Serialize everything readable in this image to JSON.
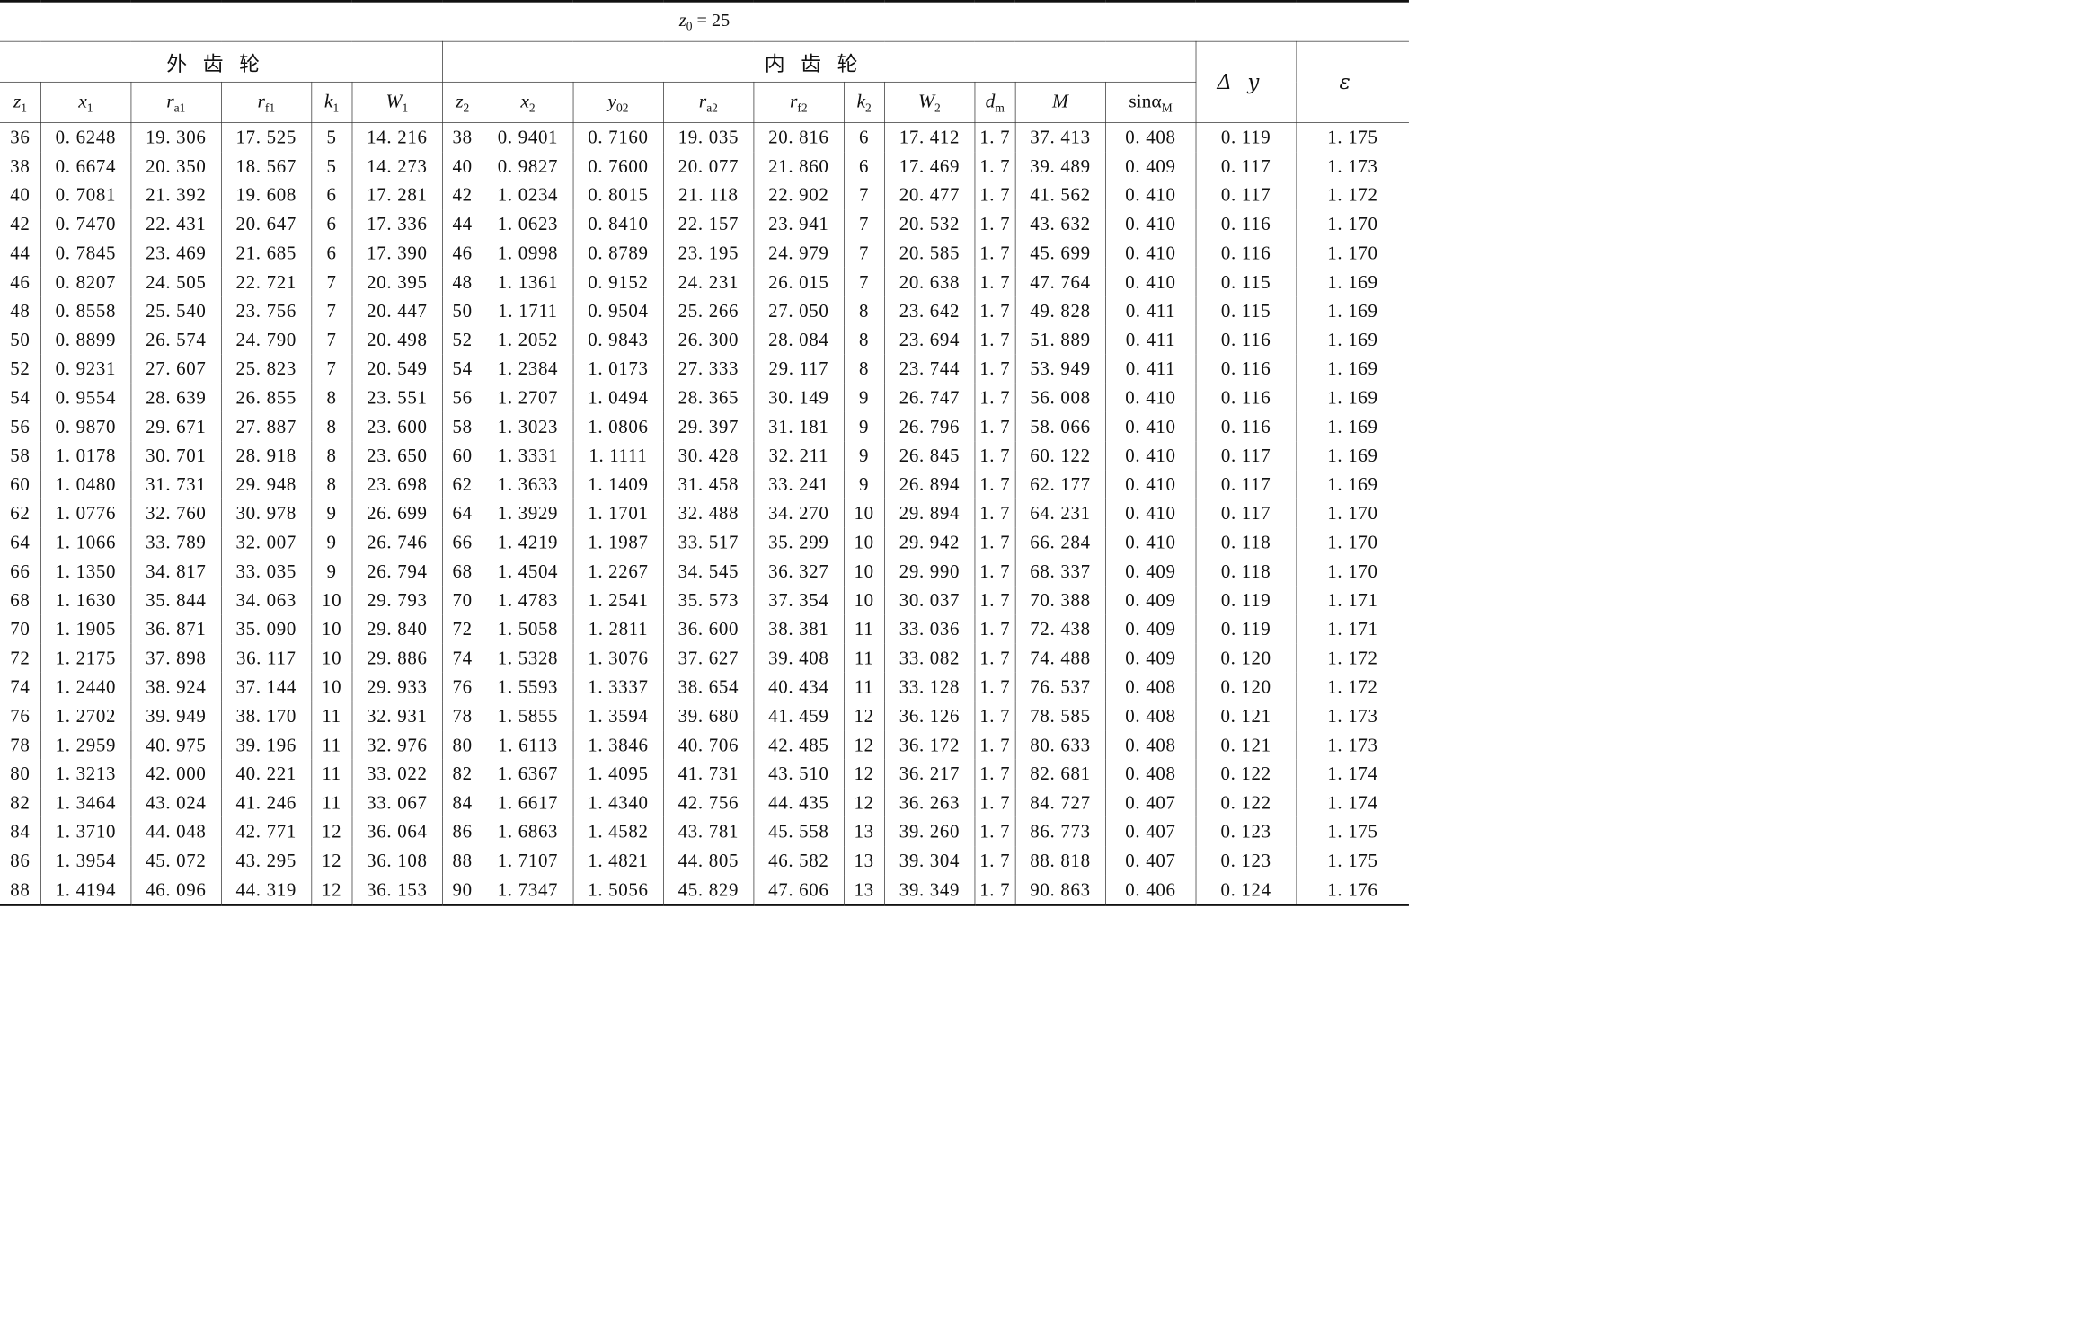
{
  "title": {
    "var": "z",
    "sub": "0",
    "rest": " = 25"
  },
  "groups": {
    "external": "外齿轮",
    "internal": "内齿轮"
  },
  "columns": [
    {
      "main": "z",
      "sub": "1"
    },
    {
      "main": "x",
      "sub": "1"
    },
    {
      "main": "r",
      "sub": "a1"
    },
    {
      "main": "r",
      "sub": "f1"
    },
    {
      "main": "k",
      "sub": "1"
    },
    {
      "main": "W",
      "sub": "1"
    },
    {
      "main": "z",
      "sub": "2"
    },
    {
      "main": "x",
      "sub": "2"
    },
    {
      "main": "y",
      "sub": "02"
    },
    {
      "main": "r",
      "sub": "a2"
    },
    {
      "main": "r",
      "sub": "f2"
    },
    {
      "main": "k",
      "sub": "2"
    },
    {
      "main": "W",
      "sub": "2"
    },
    {
      "main": "d",
      "sub": "m"
    },
    {
      "main": "M",
      "sub": ""
    },
    {
      "main": "sinα",
      "sub": "M"
    }
  ],
  "extra_columns": {
    "dy": "Δy",
    "eps": "ε"
  },
  "rows": [
    [
      "36",
      "0. 6248",
      "19. 306",
      "17. 525",
      "5",
      "14. 216",
      "38",
      "0. 9401",
      "0. 7160",
      "19. 035",
      "20. 816",
      "6",
      "17. 412",
      "1. 7",
      "37. 413",
      "0. 408",
      "0. 119",
      "1. 175"
    ],
    [
      "38",
      "0. 6674",
      "20. 350",
      "18. 567",
      "5",
      "14. 273",
      "40",
      "0. 9827",
      "0. 7600",
      "20. 077",
      "21. 860",
      "6",
      "17. 469",
      "1. 7",
      "39. 489",
      "0. 409",
      "0. 117",
      "1. 173"
    ],
    [
      "40",
      "0. 7081",
      "21. 392",
      "19. 608",
      "6",
      "17. 281",
      "42",
      "1. 0234",
      "0. 8015",
      "21. 118",
      "22. 902",
      "7",
      "20. 477",
      "1. 7",
      "41. 562",
      "0. 410",
      "0. 117",
      "1. 172"
    ],
    [
      "42",
      "0. 7470",
      "22. 431",
      "20. 647",
      "6",
      "17. 336",
      "44",
      "1. 0623",
      "0. 8410",
      "22. 157",
      "23. 941",
      "7",
      "20. 532",
      "1. 7",
      "43. 632",
      "0. 410",
      "0. 116",
      "1. 170"
    ],
    [
      "44",
      "0. 7845",
      "23. 469",
      "21. 685",
      "6",
      "17. 390",
      "46",
      "1. 0998",
      "0. 8789",
      "23. 195",
      "24. 979",
      "7",
      "20. 585",
      "1. 7",
      "45. 699",
      "0. 410",
      "0. 116",
      "1. 170"
    ],
    [
      "46",
      "0. 8207",
      "24. 505",
      "22. 721",
      "7",
      "20. 395",
      "48",
      "1. 1361",
      "0. 9152",
      "24. 231",
      "26. 015",
      "7",
      "20. 638",
      "1. 7",
      "47. 764",
      "0. 410",
      "0. 115",
      "1. 169"
    ],
    [
      "48",
      "0. 8558",
      "25. 540",
      "23. 756",
      "7",
      "20. 447",
      "50",
      "1. 1711",
      "0. 9504",
      "25. 266",
      "27. 050",
      "8",
      "23. 642",
      "1. 7",
      "49. 828",
      "0. 411",
      "0. 115",
      "1. 169"
    ],
    [
      "50",
      "0. 8899",
      "26. 574",
      "24. 790",
      "7",
      "20. 498",
      "52",
      "1. 2052",
      "0. 9843",
      "26. 300",
      "28. 084",
      "8",
      "23. 694",
      "1. 7",
      "51. 889",
      "0. 411",
      "0. 116",
      "1. 169"
    ],
    [
      "52",
      "0. 9231",
      "27. 607",
      "25. 823",
      "7",
      "20. 549",
      "54",
      "1. 2384",
      "1. 0173",
      "27. 333",
      "29. 117",
      "8",
      "23. 744",
      "1. 7",
      "53. 949",
      "0. 411",
      "0. 116",
      "1. 169"
    ],
    [
      "54",
      "0. 9554",
      "28. 639",
      "26. 855",
      "8",
      "23. 551",
      "56",
      "1. 2707",
      "1. 0494",
      "28. 365",
      "30. 149",
      "9",
      "26. 747",
      "1. 7",
      "56. 008",
      "0. 410",
      "0. 116",
      "1. 169"
    ],
    [
      "56",
      "0. 9870",
      "29. 671",
      "27. 887",
      "8",
      "23. 600",
      "58",
      "1. 3023",
      "1. 0806",
      "29. 397",
      "31. 181",
      "9",
      "26. 796",
      "1. 7",
      "58. 066",
      "0. 410",
      "0. 116",
      "1. 169"
    ],
    [
      "58",
      "1. 0178",
      "30. 701",
      "28. 918",
      "8",
      "23. 650",
      "60",
      "1. 3331",
      "1. 1111",
      "30. 428",
      "32. 211",
      "9",
      "26. 845",
      "1. 7",
      "60. 122",
      "0. 410",
      "0. 117",
      "1. 169"
    ],
    [
      "60",
      "1. 0480",
      "31. 731",
      "29. 948",
      "8",
      "23. 698",
      "62",
      "1. 3633",
      "1. 1409",
      "31. 458",
      "33. 241",
      "9",
      "26. 894",
      "1. 7",
      "62. 177",
      "0. 410",
      "0. 117",
      "1. 169"
    ],
    [
      "62",
      "1. 0776",
      "32. 760",
      "30. 978",
      "9",
      "26. 699",
      "64",
      "1. 3929",
      "1. 1701",
      "32. 488",
      "34. 270",
      "10",
      "29. 894",
      "1. 7",
      "64. 231",
      "0. 410",
      "0. 117",
      "1. 170"
    ],
    [
      "64",
      "1. 1066",
      "33. 789",
      "32. 007",
      "9",
      "26. 746",
      "66",
      "1. 4219",
      "1. 1987",
      "33. 517",
      "35. 299",
      "10",
      "29. 942",
      "1. 7",
      "66. 284",
      "0. 410",
      "0. 118",
      "1. 170"
    ],
    [
      "66",
      "1. 1350",
      "34. 817",
      "33. 035",
      "9",
      "26. 794",
      "68",
      "1. 4504",
      "1. 2267",
      "34. 545",
      "36. 327",
      "10",
      "29. 990",
      "1. 7",
      "68. 337",
      "0. 409",
      "0. 118",
      "1. 170"
    ],
    [
      "68",
      "1. 1630",
      "35. 844",
      "34. 063",
      "10",
      "29. 793",
      "70",
      "1. 4783",
      "1. 2541",
      "35. 573",
      "37. 354",
      "10",
      "30. 037",
      "1. 7",
      "70. 388",
      "0. 409",
      "0. 119",
      "1. 171"
    ],
    [
      "70",
      "1. 1905",
      "36. 871",
      "35. 090",
      "10",
      "29. 840",
      "72",
      "1. 5058",
      "1. 2811",
      "36. 600",
      "38. 381",
      "11",
      "33. 036",
      "1. 7",
      "72. 438",
      "0. 409",
      "0. 119",
      "1. 171"
    ],
    [
      "72",
      "1. 2175",
      "37. 898",
      "36. 117",
      "10",
      "29. 886",
      "74",
      "1. 5328",
      "1. 3076",
      "37. 627",
      "39. 408",
      "11",
      "33. 082",
      "1. 7",
      "74. 488",
      "0. 409",
      "0. 120",
      "1. 172"
    ],
    [
      "74",
      "1. 2440",
      "38. 924",
      "37. 144",
      "10",
      "29. 933",
      "76",
      "1. 5593",
      "1. 3337",
      "38. 654",
      "40. 434",
      "11",
      "33. 128",
      "1. 7",
      "76. 537",
      "0. 408",
      "0. 120",
      "1. 172"
    ],
    [
      "76",
      "1. 2702",
      "39. 949",
      "38. 170",
      "11",
      "32. 931",
      "78",
      "1. 5855",
      "1. 3594",
      "39. 680",
      "41. 459",
      "12",
      "36. 126",
      "1. 7",
      "78. 585",
      "0. 408",
      "0. 121",
      "1. 173"
    ],
    [
      "78",
      "1. 2959",
      "40. 975",
      "39. 196",
      "11",
      "32. 976",
      "80",
      "1. 6113",
      "1. 3846",
      "40. 706",
      "42. 485",
      "12",
      "36. 172",
      "1. 7",
      "80. 633",
      "0. 408",
      "0. 121",
      "1. 173"
    ],
    [
      "80",
      "1. 3213",
      "42. 000",
      "40. 221",
      "11",
      "33. 022",
      "82",
      "1. 6367",
      "1. 4095",
      "41. 731",
      "43. 510",
      "12",
      "36. 217",
      "1. 7",
      "82. 681",
      "0. 408",
      "0. 122",
      "1. 174"
    ],
    [
      "82",
      "1. 3464",
      "43. 024",
      "41. 246",
      "11",
      "33. 067",
      "84",
      "1. 6617",
      "1. 4340",
      "42. 756",
      "44. 435",
      "12",
      "36. 263",
      "1. 7",
      "84. 727",
      "0. 407",
      "0. 122",
      "1. 174"
    ],
    [
      "84",
      "1. 3710",
      "44. 048",
      "42. 771",
      "12",
      "36. 064",
      "86",
      "1. 6863",
      "1. 4582",
      "43. 781",
      "45. 558",
      "13",
      "39. 260",
      "1. 7",
      "86. 773",
      "0. 407",
      "0. 123",
      "1. 175"
    ],
    [
      "86",
      "1. 3954",
      "45. 072",
      "43. 295",
      "12",
      "36. 108",
      "88",
      "1. 7107",
      "1. 4821",
      "44. 805",
      "46. 582",
      "13",
      "39. 304",
      "1. 7",
      "88. 818",
      "0. 407",
      "0. 123",
      "1. 175"
    ],
    [
      "88",
      "1. 4194",
      "46. 096",
      "44. 319",
      "12",
      "36. 153",
      "90",
      "1. 7347",
      "1. 5056",
      "45. 829",
      "47. 606",
      "13",
      "39. 349",
      "1. 7",
      "90. 863",
      "0. 406",
      "0. 124",
      "1. 176"
    ]
  ]
}
